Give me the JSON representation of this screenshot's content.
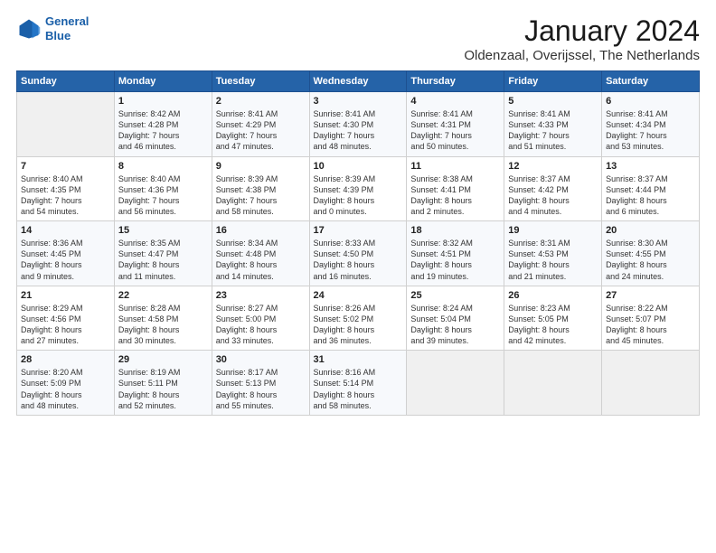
{
  "header": {
    "logo_line1": "General",
    "logo_line2": "Blue",
    "title": "January 2024",
    "subtitle": "Oldenzaal, Overijssel, The Netherlands"
  },
  "days_of_week": [
    "Sunday",
    "Monday",
    "Tuesday",
    "Wednesday",
    "Thursday",
    "Friday",
    "Saturday"
  ],
  "weeks": [
    [
      {
        "day": "",
        "info": ""
      },
      {
        "day": "1",
        "info": "Sunrise: 8:42 AM\nSunset: 4:28 PM\nDaylight: 7 hours\nand 46 minutes."
      },
      {
        "day": "2",
        "info": "Sunrise: 8:41 AM\nSunset: 4:29 PM\nDaylight: 7 hours\nand 47 minutes."
      },
      {
        "day": "3",
        "info": "Sunrise: 8:41 AM\nSunset: 4:30 PM\nDaylight: 7 hours\nand 48 minutes."
      },
      {
        "day": "4",
        "info": "Sunrise: 8:41 AM\nSunset: 4:31 PM\nDaylight: 7 hours\nand 50 minutes."
      },
      {
        "day": "5",
        "info": "Sunrise: 8:41 AM\nSunset: 4:33 PM\nDaylight: 7 hours\nand 51 minutes."
      },
      {
        "day": "6",
        "info": "Sunrise: 8:41 AM\nSunset: 4:34 PM\nDaylight: 7 hours\nand 53 minutes."
      }
    ],
    [
      {
        "day": "7",
        "info": "Sunrise: 8:40 AM\nSunset: 4:35 PM\nDaylight: 7 hours\nand 54 minutes."
      },
      {
        "day": "8",
        "info": "Sunrise: 8:40 AM\nSunset: 4:36 PM\nDaylight: 7 hours\nand 56 minutes."
      },
      {
        "day": "9",
        "info": "Sunrise: 8:39 AM\nSunset: 4:38 PM\nDaylight: 7 hours\nand 58 minutes."
      },
      {
        "day": "10",
        "info": "Sunrise: 8:39 AM\nSunset: 4:39 PM\nDaylight: 8 hours\nand 0 minutes."
      },
      {
        "day": "11",
        "info": "Sunrise: 8:38 AM\nSunset: 4:41 PM\nDaylight: 8 hours\nand 2 minutes."
      },
      {
        "day": "12",
        "info": "Sunrise: 8:37 AM\nSunset: 4:42 PM\nDaylight: 8 hours\nand 4 minutes."
      },
      {
        "day": "13",
        "info": "Sunrise: 8:37 AM\nSunset: 4:44 PM\nDaylight: 8 hours\nand 6 minutes."
      }
    ],
    [
      {
        "day": "14",
        "info": "Sunrise: 8:36 AM\nSunset: 4:45 PM\nDaylight: 8 hours\nand 9 minutes."
      },
      {
        "day": "15",
        "info": "Sunrise: 8:35 AM\nSunset: 4:47 PM\nDaylight: 8 hours\nand 11 minutes."
      },
      {
        "day": "16",
        "info": "Sunrise: 8:34 AM\nSunset: 4:48 PM\nDaylight: 8 hours\nand 14 minutes."
      },
      {
        "day": "17",
        "info": "Sunrise: 8:33 AM\nSunset: 4:50 PM\nDaylight: 8 hours\nand 16 minutes."
      },
      {
        "day": "18",
        "info": "Sunrise: 8:32 AM\nSunset: 4:51 PM\nDaylight: 8 hours\nand 19 minutes."
      },
      {
        "day": "19",
        "info": "Sunrise: 8:31 AM\nSunset: 4:53 PM\nDaylight: 8 hours\nand 21 minutes."
      },
      {
        "day": "20",
        "info": "Sunrise: 8:30 AM\nSunset: 4:55 PM\nDaylight: 8 hours\nand 24 minutes."
      }
    ],
    [
      {
        "day": "21",
        "info": "Sunrise: 8:29 AM\nSunset: 4:56 PM\nDaylight: 8 hours\nand 27 minutes."
      },
      {
        "day": "22",
        "info": "Sunrise: 8:28 AM\nSunset: 4:58 PM\nDaylight: 8 hours\nand 30 minutes."
      },
      {
        "day": "23",
        "info": "Sunrise: 8:27 AM\nSunset: 5:00 PM\nDaylight: 8 hours\nand 33 minutes."
      },
      {
        "day": "24",
        "info": "Sunrise: 8:26 AM\nSunset: 5:02 PM\nDaylight: 8 hours\nand 36 minutes."
      },
      {
        "day": "25",
        "info": "Sunrise: 8:24 AM\nSunset: 5:04 PM\nDaylight: 8 hours\nand 39 minutes."
      },
      {
        "day": "26",
        "info": "Sunrise: 8:23 AM\nSunset: 5:05 PM\nDaylight: 8 hours\nand 42 minutes."
      },
      {
        "day": "27",
        "info": "Sunrise: 8:22 AM\nSunset: 5:07 PM\nDaylight: 8 hours\nand 45 minutes."
      }
    ],
    [
      {
        "day": "28",
        "info": "Sunrise: 8:20 AM\nSunset: 5:09 PM\nDaylight: 8 hours\nand 48 minutes."
      },
      {
        "day": "29",
        "info": "Sunrise: 8:19 AM\nSunset: 5:11 PM\nDaylight: 8 hours\nand 52 minutes."
      },
      {
        "day": "30",
        "info": "Sunrise: 8:17 AM\nSunset: 5:13 PM\nDaylight: 8 hours\nand 55 minutes."
      },
      {
        "day": "31",
        "info": "Sunrise: 8:16 AM\nSunset: 5:14 PM\nDaylight: 8 hours\nand 58 minutes."
      },
      {
        "day": "",
        "info": ""
      },
      {
        "day": "",
        "info": ""
      },
      {
        "day": "",
        "info": ""
      }
    ]
  ]
}
